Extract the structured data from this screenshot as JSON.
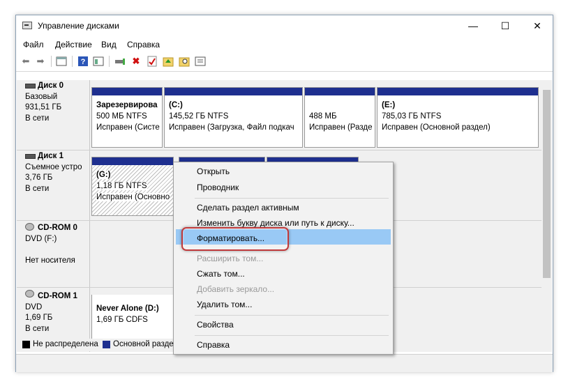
{
  "window": {
    "title": "Управление дисками",
    "minimize": "—",
    "maximize": "☐",
    "close": "✕"
  },
  "menu": [
    "Файл",
    "Действие",
    "Вид",
    "Справка"
  ],
  "toolbar_icons": [
    "back-icon",
    "forward-icon",
    "panel-icon",
    "help-icon",
    "panel2-icon",
    "connect-icon",
    "delete-icon",
    "checklist-icon",
    "up-icon",
    "search-icon",
    "properties-icon"
  ],
  "disks": [
    {
      "name": "Диск 0",
      "type": "Базовый",
      "size": "931,51 ГБ",
      "status": "В сети",
      "partitions": [
        {
          "title": "Зарезервирова",
          "size": "500 МБ NTFS",
          "state": "Исправен (Систе"
        },
        {
          "title": "(C:)",
          "size": "145,52 ГБ NTFS",
          "state": "Исправен (Загрузка, Файл подкач"
        },
        {
          "title": "",
          "size": "488 МБ",
          "state": "Исправен (Разде"
        },
        {
          "title": "(E:)",
          "size": "785,03 ГБ NTFS",
          "state": "Исправен (Основной раздел)"
        }
      ]
    },
    {
      "name": "Диск 1",
      "type": "Съемное устро",
      "size": "3,76 ГБ",
      "status": "В сети",
      "partitions": [
        {
          "title": "(G:)",
          "size": "1,18 ГБ NTFS",
          "state": "Исправен (Основно"
        }
      ]
    },
    {
      "name": "CD-ROM 0",
      "type": "DVD (F:)",
      "size": "",
      "status": "Нет носителя",
      "partitions": []
    },
    {
      "name": "CD-ROM 1",
      "type": "DVD",
      "size": "1,69 ГБ",
      "status": "В сети",
      "partitions": [
        {
          "title": "Never Alone (D:)",
          "size": "1,69 ГБ CDFS",
          "state": ""
        }
      ]
    }
  ],
  "legend": [
    {
      "label": "Не распределена",
      "color": "#000000"
    },
    {
      "label": "Основной разде",
      "color": "#1e2f8f"
    }
  ],
  "context_menu": {
    "items": [
      {
        "label": "Открыть",
        "disabled": false
      },
      {
        "label": "Проводник",
        "disabled": false
      },
      {
        "label": "Сделать раздел активным",
        "disabled": false
      },
      {
        "label": "Изменить букву диска или путь к диску...",
        "disabled": false
      },
      {
        "label": "Форматировать...",
        "disabled": false,
        "highlighted": true
      },
      {
        "label": "Расширить том...",
        "disabled": true
      },
      {
        "label": "Сжать том...",
        "disabled": false
      },
      {
        "label": "Добавить зеркало...",
        "disabled": true
      },
      {
        "label": "Удалить том...",
        "disabled": false
      },
      {
        "label": "Свойства",
        "disabled": false
      },
      {
        "label": "Справка",
        "disabled": false
      }
    ]
  },
  "colors": {
    "partition_bar": "#1e2f8f",
    "highlight": "#99c9f5",
    "callout": "#c0393b"
  }
}
